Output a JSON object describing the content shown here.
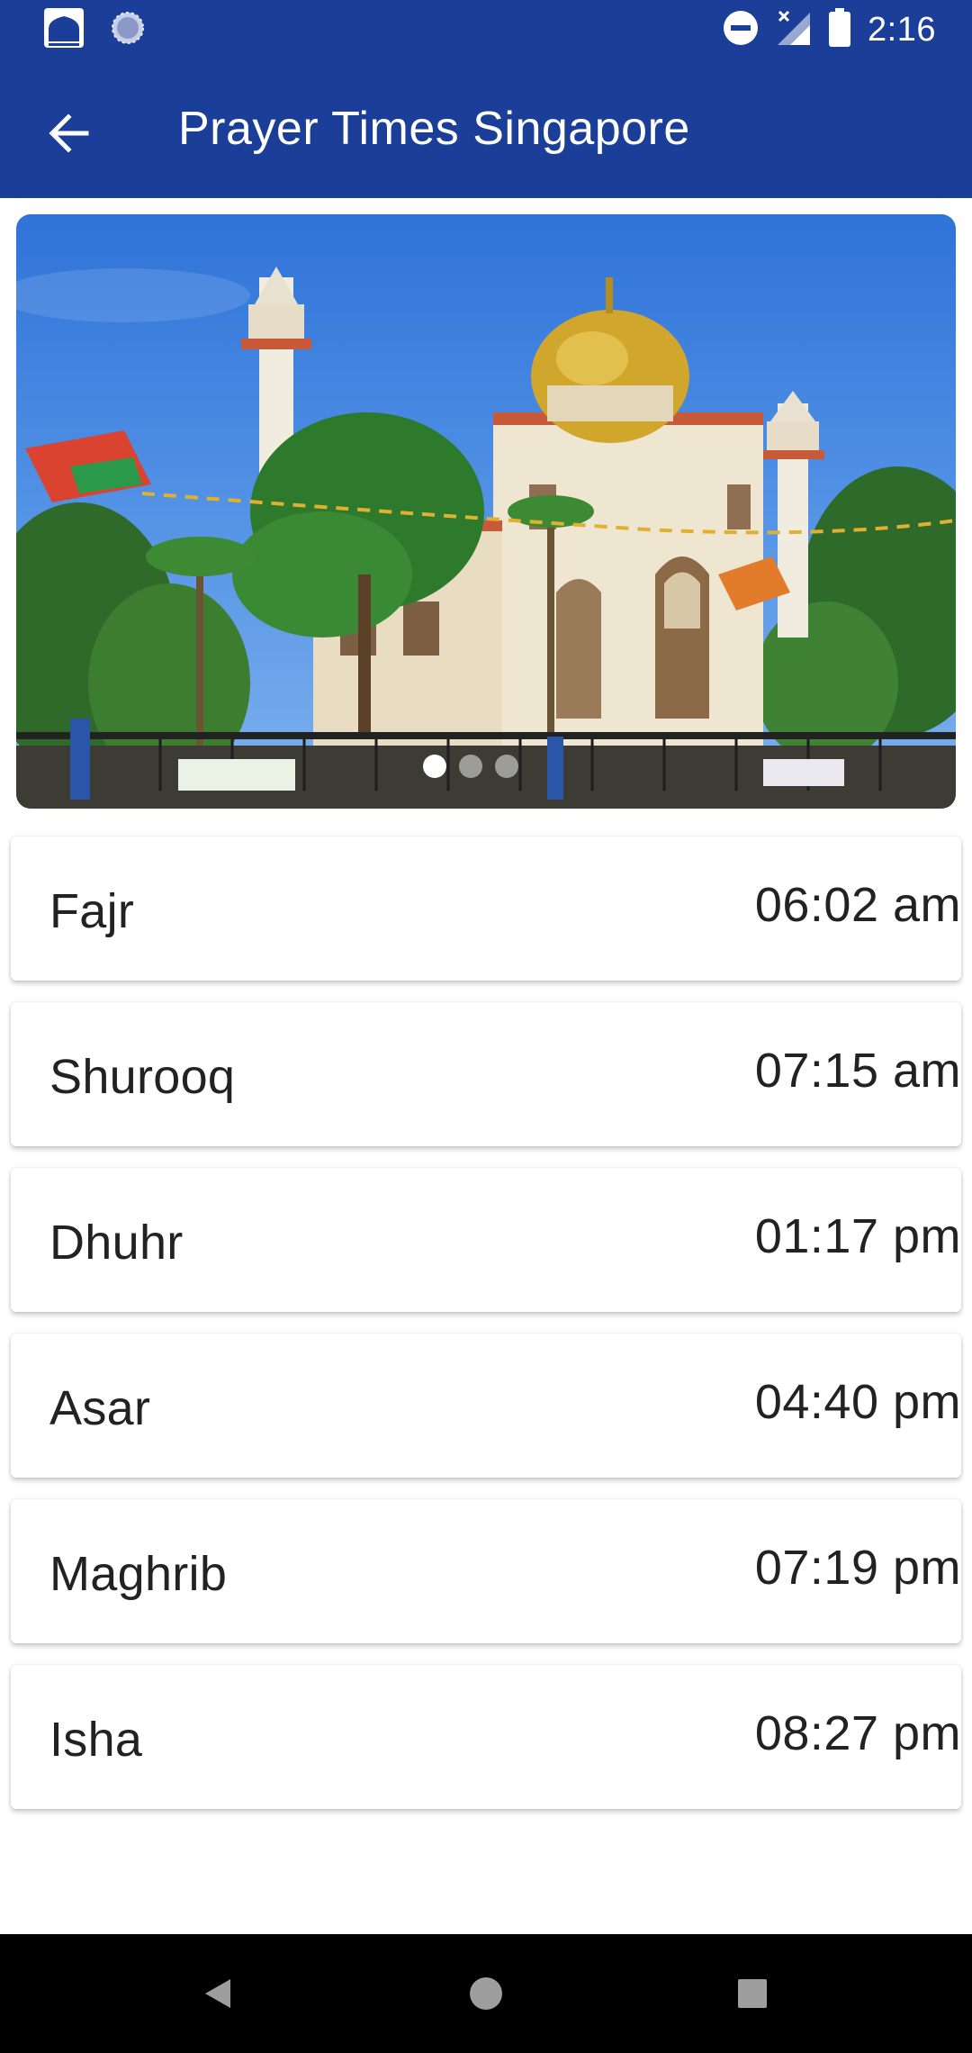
{
  "status_bar": {
    "time": "2:16",
    "left_icons": [
      "mosque-app-icon",
      "sync-icon"
    ],
    "right_icons": [
      "do-not-disturb-icon",
      "no-signal-icon",
      "battery-icon"
    ]
  },
  "app_bar": {
    "title": "Prayer Times Singapore",
    "back_icon": "arrow-back-icon",
    "color": "#1b3f98"
  },
  "banner": {
    "image": "mosque-photo",
    "slides": 3,
    "active_slide": 1
  },
  "prayers": [
    {
      "name": "Fajr",
      "time": "06:02 am"
    },
    {
      "name": "Shurooq",
      "time": "07:15 am"
    },
    {
      "name": "Dhuhr",
      "time": "01:17 pm"
    },
    {
      "name": "Asar",
      "time": "04:40 pm"
    },
    {
      "name": "Maghrib",
      "time": "07:19 pm"
    },
    {
      "name": "Isha",
      "time": "08:27 pm"
    }
  ],
  "nav_bar": {
    "buttons": [
      "back-triangle-icon",
      "home-circle-icon",
      "recents-square-icon"
    ]
  }
}
